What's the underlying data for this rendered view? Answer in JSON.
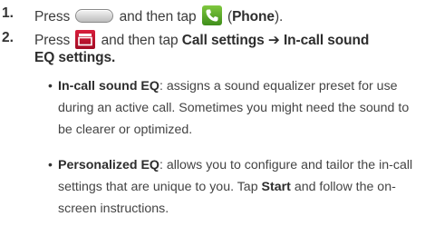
{
  "steps": [
    {
      "number": "1.",
      "text_before": "Press",
      "text_middle": "and then tap",
      "text_open_paren": "(",
      "app_label": "Phone",
      "text_close": ")."
    },
    {
      "number": "2.",
      "text_before": "Press",
      "text_middle": "and then tap",
      "menu_path": "Call settings ➔ In-call sound",
      "menu_path_cont": "EQ settings."
    }
  ],
  "options": [
    {
      "title": "In-call sound EQ",
      "lines": [
        ": assigns a sound equalizer preset for use",
        "during an active call. Sometimes you might need the sound to",
        "be clearer or optimized."
      ]
    },
    {
      "title": "Personalized EQ",
      "lines": [
        ": allows you to configure and tailor the in-call",
        "settings that are unique to you. Tap ",
        "and follow the on-",
        "screen instructions."
      ],
      "start_label": "Start"
    }
  ],
  "icons": {
    "home_key": "home-key-icon",
    "phone_app": "phone-app-icon",
    "menu_key": "menu-key-icon"
  },
  "colors": {
    "text": "#3c3c3c",
    "phone_icon_green": "#4fa324",
    "menu_icon_red": "#c4132f"
  }
}
